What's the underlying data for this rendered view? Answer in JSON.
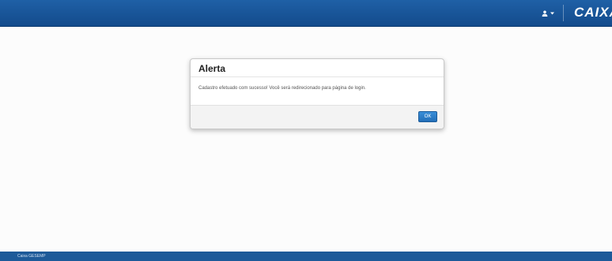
{
  "header": {
    "user_menu_icon": "user-icon",
    "caret_icon": "chevron-down-icon",
    "logo_text": "CAIXA"
  },
  "dialog": {
    "title": "Alerta",
    "message": "Cadastro efetuado com sucesso! Você será redirecionado para página de login.",
    "ok_label": "OK"
  },
  "footer": {
    "text": "Caixa GESEMP"
  },
  "colors": {
    "header_bg": "#1a559a",
    "footer_bg": "#1d5a99",
    "button_bg": "#2c7fcb",
    "page_bg": "#fbfbfb"
  }
}
